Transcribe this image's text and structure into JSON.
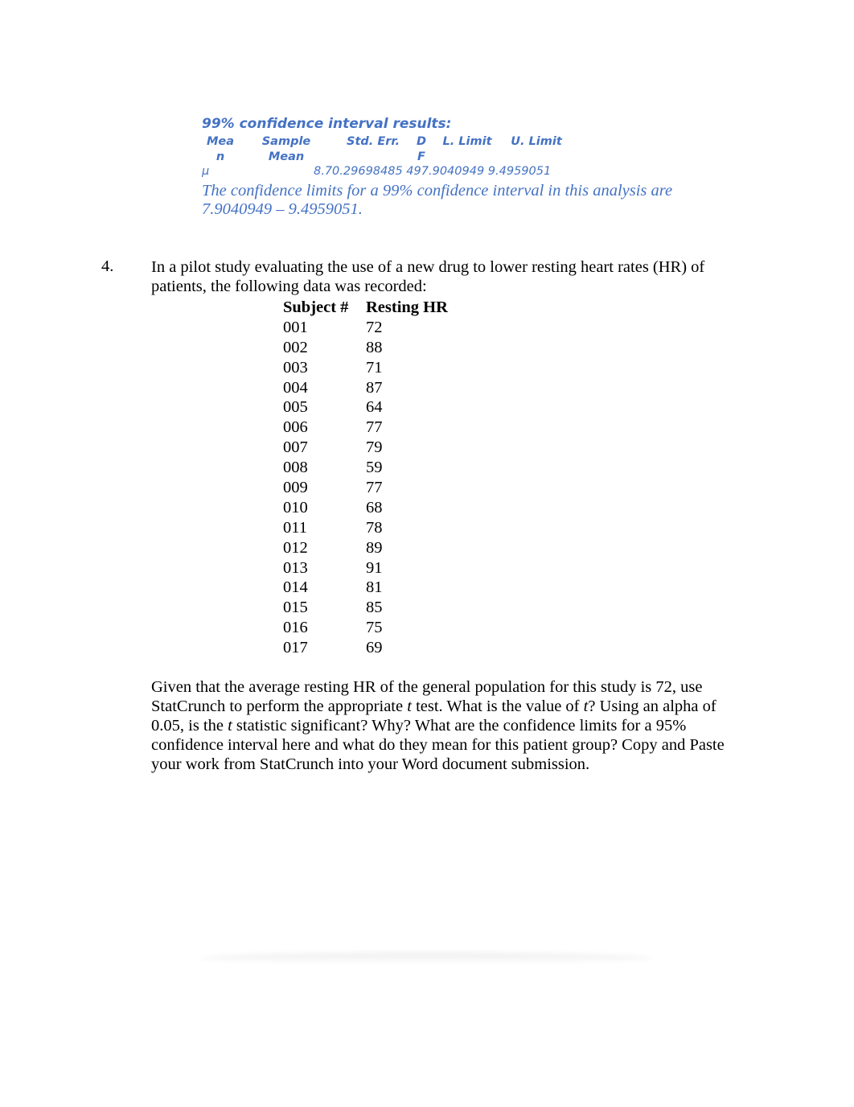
{
  "ci_results": {
    "title": "99% confidence interval results:",
    "headers": {
      "mean_line1": "Mea",
      "mean_line2": "n",
      "sample_mean_line1": "Sample",
      "sample_mean_line2": "Mean",
      "std_err": "Std. Err.",
      "df_line1": "D",
      "df_line2": "F",
      "l_limit": "L. Limit",
      "u_limit": "U. Limit"
    },
    "row": {
      "mean": "μ",
      "values": "8.70.29698485 497.9040949 9.4959051"
    },
    "sentence": "The confidence limits for a 99% confidence interval in this analysis are 7.9040949 – 9.4959051."
  },
  "question": {
    "number": "4.",
    "intro": "In a pilot study evaluating the use of a new drug to lower resting heart rates (HR) of patients, the following data was recorded:",
    "table": {
      "headers": [
        "Subject #",
        "Resting HR"
      ],
      "rows": [
        [
          "001",
          "72"
        ],
        [
          "002",
          "88"
        ],
        [
          "003",
          "71"
        ],
        [
          "004",
          "87"
        ],
        [
          "005",
          "64"
        ],
        [
          "006",
          "77"
        ],
        [
          "007",
          "79"
        ],
        [
          "008",
          "59"
        ],
        [
          "009",
          "77"
        ],
        [
          "010",
          "68"
        ],
        [
          "011",
          "78"
        ],
        [
          "012",
          "89"
        ],
        [
          "013",
          "91"
        ],
        [
          "014",
          "81"
        ],
        [
          "015",
          "85"
        ],
        [
          "016",
          "75"
        ],
        [
          "017",
          "69"
        ]
      ]
    },
    "paragraph": {
      "p1": "Given that the average resting HR of the general population for this study is 72, use StatCrunch to perform the appropriate ",
      "t1": "t",
      "p2": " test.  What is the value of ",
      "t2": "t",
      "p3": "?  Using an alpha of 0.05, is the ",
      "t3": "t",
      "p4": " statistic significant?  Why?  What are the confidence limits for a 95% confidence interval here and what do they mean for this patient group?  Copy and Paste your work from StatCrunch into your Word document submission."
    }
  }
}
